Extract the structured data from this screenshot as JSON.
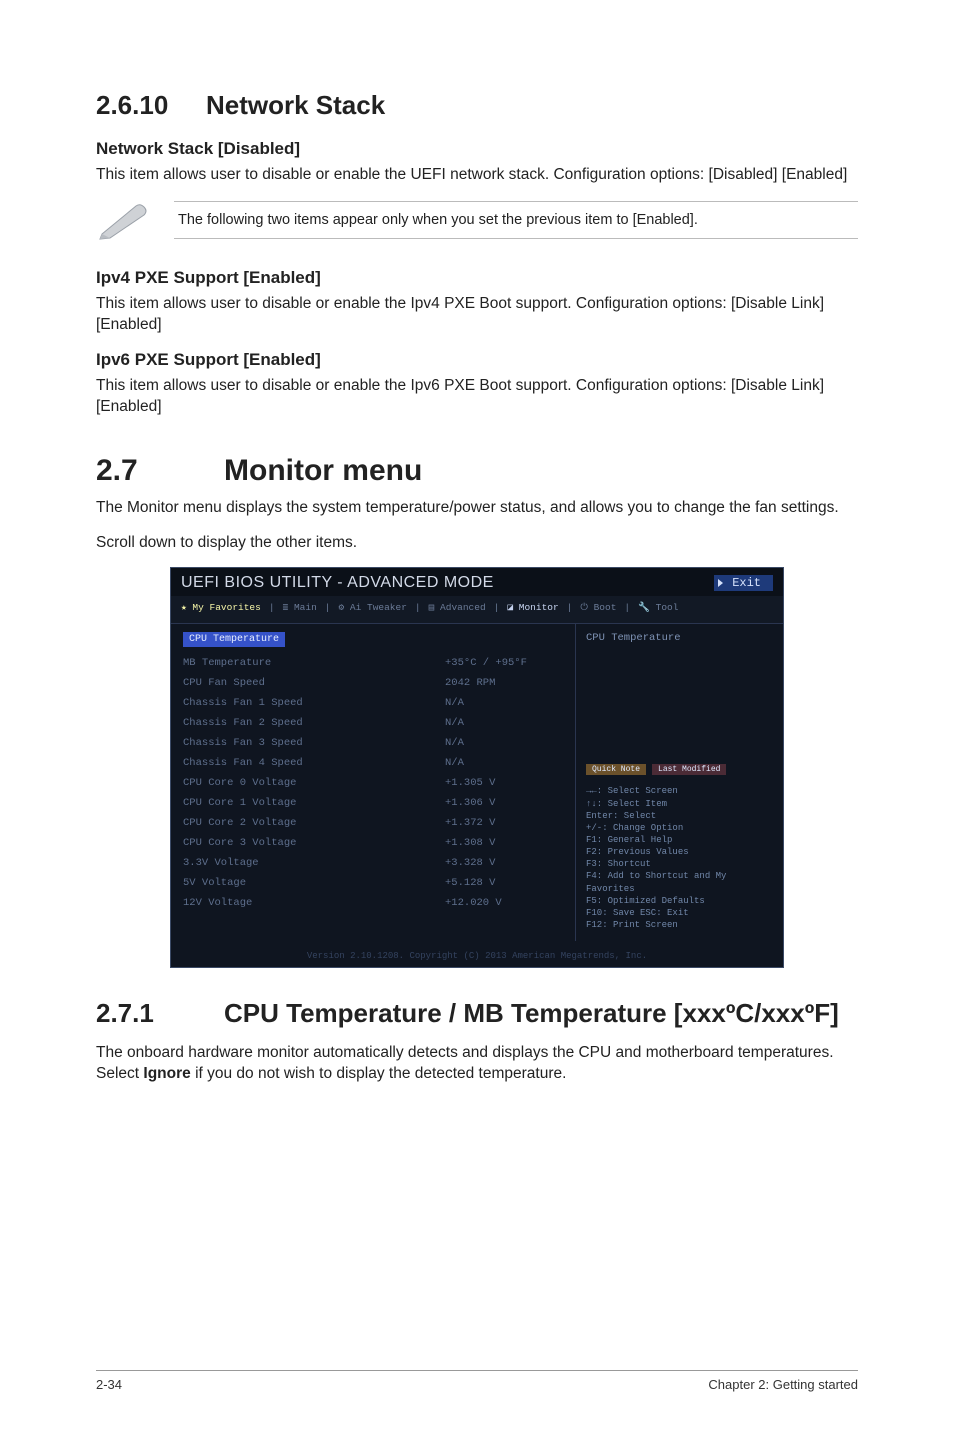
{
  "section2610": {
    "number": "2.6.10",
    "title": "Network Stack",
    "net_stack_heading": "Network Stack [Disabled]",
    "net_stack_body": "This item allows user to disable or enable the UEFI network stack. Configuration options: [Disabled] [Enabled]",
    "note_text": "The following two items appear only when you set the previous item to [Enabled].",
    "ipv4_heading": "Ipv4 PXE Support [Enabled]",
    "ipv4_body": "This item allows user to disable or enable the Ipv4 PXE Boot support. Configuration options: [Disable Link] [Enabled]",
    "ipv6_heading": "Ipv6 PXE Support [Enabled]",
    "ipv6_body": "This item allows user to disable or enable the Ipv6 PXE Boot support. Configuration options: [Disable Link] [Enabled]"
  },
  "section27": {
    "number": "2.7",
    "title": "Monitor menu",
    "intro1": "The Monitor menu displays the system temperature/power status, and allows you to change the fan settings.",
    "intro2": "Scroll down to display the other items."
  },
  "bios": {
    "window_title": "UEFI BIOS UTILITY - ADVANCED MODE",
    "exit_label": "Exit",
    "tabs": {
      "fav": "★ My Favorites",
      "main": "≣ Main",
      "tweaker": "⚙ Ai Tweaker",
      "advanced": "▤ Advanced",
      "monitor": "◪ Monitor",
      "boot": "⏻ Boot",
      "tool": "🔧 Tool"
    },
    "left_header": "CPU Temperature",
    "rows": [
      {
        "label": "MB Temperature",
        "value": "+35°C / +95°F"
      },
      {
        "label": "CPU Fan Speed",
        "value": "2042 RPM"
      },
      {
        "label": "Chassis Fan 1 Speed",
        "value": "N/A"
      },
      {
        "label": "Chassis Fan 2 Speed",
        "value": "N/A"
      },
      {
        "label": "Chassis Fan 3 Speed",
        "value": "N/A"
      },
      {
        "label": "Chassis Fan 4 Speed",
        "value": "N/A"
      },
      {
        "label": "CPU Core 0 Voltage",
        "value": "+1.305 V"
      },
      {
        "label": "CPU Core 1 Voltage",
        "value": "+1.306 V"
      },
      {
        "label": "CPU Core 2 Voltage",
        "value": "+1.372 V"
      },
      {
        "label": "CPU Core 3 Voltage",
        "value": "+1.308 V"
      },
      {
        "label": "3.3V Voltage",
        "value": "+3.328 V"
      },
      {
        "label": "5V Voltage",
        "value": "+5.128 V"
      },
      {
        "label": "12V Voltage",
        "value": "+12.020 V"
      }
    ],
    "right_top": "CPU Temperature",
    "quick_note": "Quick Note",
    "last_mod": "Last Modified",
    "help": "→←: Select Screen\n↑↓: Select Item\nEnter: Select\n+/-: Change Option\nF1: General Help\nF2: Previous Values\nF3: Shortcut\nF4: Add to Shortcut and My Favorites\nF5: Optimized Defaults\nF10: Save  ESC: Exit\nF12: Print Screen",
    "version": "Version 2.10.1208. Copyright (C) 2013 American Megatrends, Inc."
  },
  "section271": {
    "number": "2.7.1",
    "title": "CPU Temperature / MB Temperature [xxxºC/xxxºF]",
    "body_pre": "The onboard hardware monitor automatically detects and displays the CPU and motherboard temperatures. Select ",
    "body_bold": "Ignore",
    "body_post": " if you do not wish to display the detected temperature."
  },
  "footer": {
    "page": "2-34",
    "chapter": "Chapter 2: Getting started"
  }
}
